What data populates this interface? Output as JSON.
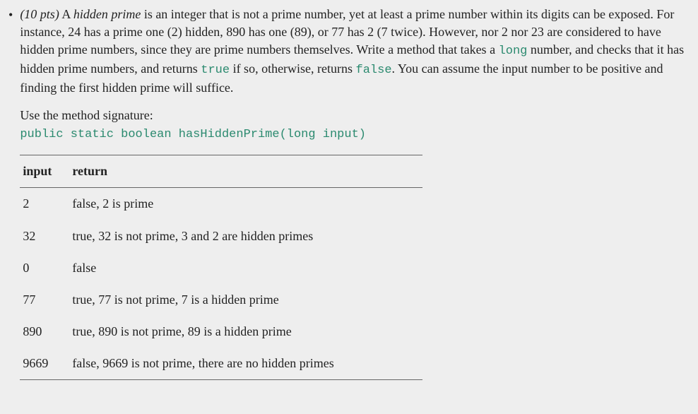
{
  "bullet": "•",
  "problem": {
    "points_prefix": "(10 pts)",
    "intro_text": " A ",
    "term": "hidden prime",
    "description": " is an integer that is not a prime number, yet at least a prime number within its digits can be exposed. For instance, 24 has a prime one (2) hidden, 890 has one (89), or 77 has 2 (7 twice). However, nor 2 nor 23 are considered to have hidden prime numbers, since they are prime numbers themselves. Write a method that takes a ",
    "code_long": "long",
    "desc_part2": " number, and checks that it has hidden prime numbers, and returns ",
    "code_true": "true",
    "desc_part3": " if so, otherwise, returns ",
    "code_false": "false",
    "desc_part4": ". You can assume the input number to be positive and finding the first hidden prime will suffice."
  },
  "signature_intro": "Use the method signature:",
  "signature": "public static boolean hasHiddenPrime(long input)",
  "table": {
    "header_input": "input",
    "header_return": "return",
    "rows": [
      {
        "input": "2",
        "return": "false, 2 is prime"
      },
      {
        "input": "32",
        "return": "true, 32 is not prime, 3 and 2 are hidden primes"
      },
      {
        "input": "0",
        "return": "false"
      },
      {
        "input": "77",
        "return": "true, 77 is not prime, 7 is a hidden prime"
      },
      {
        "input": "890",
        "return": "true, 890 is not prime, 89 is a hidden prime"
      },
      {
        "input": "9669",
        "return": "false, 9669 is not prime, there are no hidden primes"
      }
    ]
  }
}
